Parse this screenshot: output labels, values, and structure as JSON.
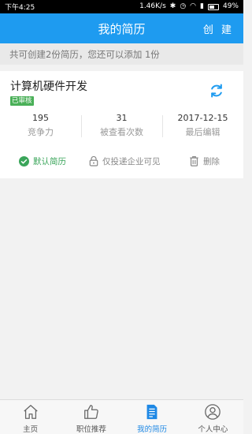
{
  "status_bar": {
    "time": "下午4:25",
    "speed": "1.46K/s",
    "battery": "49%"
  },
  "header": {
    "title": "我的简历",
    "create_label": "创 建"
  },
  "notice": "共可创建2份简历，您还可以添加 1份",
  "resume": {
    "title": "计算机硬件开发",
    "status_badge": "已审核",
    "stats": [
      {
        "value": "195",
        "label": "竞争力"
      },
      {
        "value": "31",
        "label": "被查看次数"
      },
      {
        "value": "2017-12-15",
        "label": "最后编辑"
      }
    ],
    "actions": {
      "default_label": "默认简历",
      "visibility_label": "仅投递企业可见",
      "delete_label": "删除"
    }
  },
  "tabbar": {
    "items": [
      {
        "label": "主页",
        "icon": "home-icon"
      },
      {
        "label": "职位推荐",
        "icon": "thumbs-up-icon"
      },
      {
        "label": "我的简历",
        "icon": "document-icon"
      },
      {
        "label": "个人中心",
        "icon": "user-icon"
      }
    ],
    "active_index": 2
  },
  "colors": {
    "primary": "#1e9bf0",
    "tab_active": "#1e88e5",
    "success": "#3aa55a",
    "badge": "#4ab058"
  }
}
